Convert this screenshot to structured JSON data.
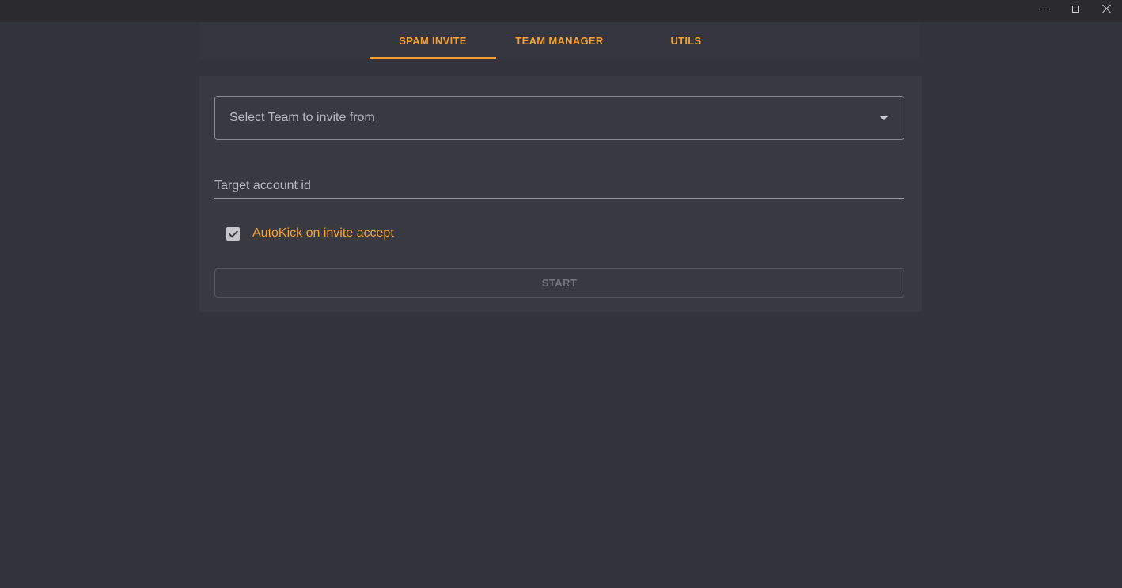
{
  "window": {
    "controls": {
      "minimize_icon": "minimize-icon",
      "maximize_icon": "maximize-icon",
      "close_icon": "close-icon"
    }
  },
  "tabs": [
    {
      "label": "SPAM INVITE",
      "active": true
    },
    {
      "label": "TEAM MANAGER",
      "active": false
    },
    {
      "label": "UTILS",
      "active": false
    }
  ],
  "form": {
    "team_select": {
      "placeholder": "Select Team to invite from",
      "icon": "caret-down-icon"
    },
    "target_account": {
      "placeholder": "Target account id",
      "value": ""
    },
    "autokick": {
      "label": "AutoKick on invite accept",
      "checked": true
    },
    "start_label": "START"
  },
  "colors": {
    "accent": "#f5a030",
    "background": "#33333d",
    "card": "#393942"
  }
}
